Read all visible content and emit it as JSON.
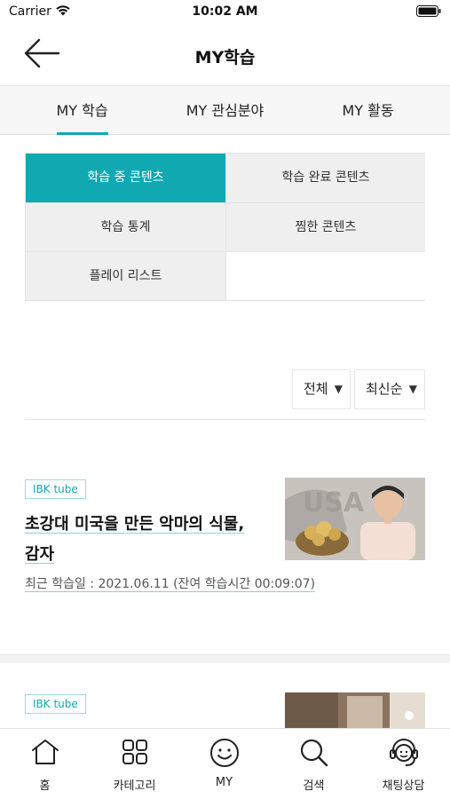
{
  "status_bar": {
    "carrier": "Carrier",
    "time": "10:02 AM"
  },
  "nav": {
    "title": "MY학습",
    "back_icon": "back-arrow-icon"
  },
  "tabs": [
    {
      "label": "MY 학습",
      "active": true
    },
    {
      "label": "MY 관심분야",
      "active": false
    },
    {
      "label": "MY 활동",
      "active": false
    }
  ],
  "categories": [
    {
      "label": "학습 중 콘텐츠",
      "active": true
    },
    {
      "label": "학습 완료 콘텐츠",
      "active": false
    },
    {
      "label": "학습 통계",
      "active": false
    },
    {
      "label": "찜한 콘텐츠",
      "active": false
    },
    {
      "label": "플레이 리스트",
      "active": false
    }
  ],
  "filters": {
    "type": "전체",
    "sort": "최신순"
  },
  "cards": [
    {
      "badge": "IBK tube",
      "title_line1": "초강대 미국을 만든 악마의 식물,",
      "title_line2": "감자",
      "date": "최근 학습일 : 2021.06.11 (잔여 학습시간 00:09:07)"
    },
    {
      "badge": "IBK tube"
    }
  ],
  "bottom_nav": [
    {
      "label": "홈",
      "icon": "home-icon"
    },
    {
      "label": "카테고리",
      "icon": "category-grid-icon"
    },
    {
      "label": "MY",
      "icon": "smile-icon"
    },
    {
      "label": "검색",
      "icon": "search-icon"
    },
    {
      "label": "채팅상담",
      "icon": "headset-icon"
    }
  ],
  "colors": {
    "accent": "#10a9b2"
  }
}
